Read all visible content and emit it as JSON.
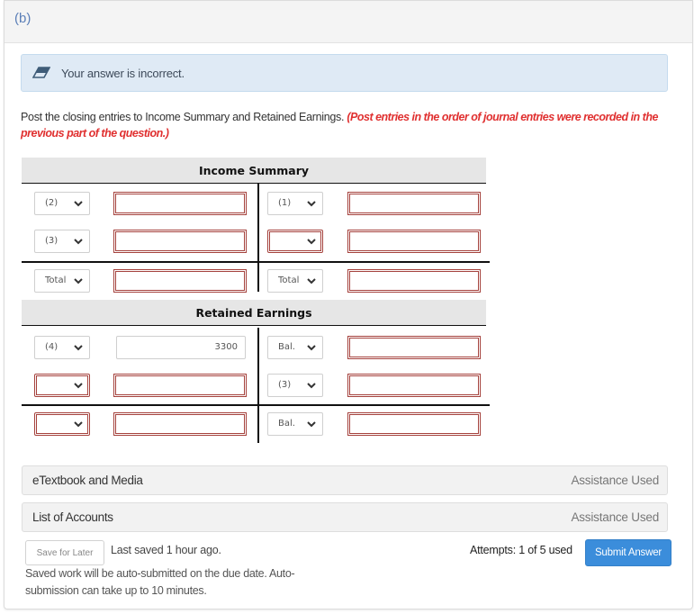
{
  "part": {
    "label": "(b)"
  },
  "feedback": {
    "icon": "eraser-icon",
    "text": "Your answer is incorrect."
  },
  "instructions": {
    "text": "Post the closing entries to Income Summary and Retained Earnings.",
    "note": "(Post entries in the order of journal entries were recorded in the previous part of the question.)"
  },
  "income_summary": {
    "title": "Income Summary",
    "debit_rows": [
      {
        "ref": "(2)",
        "amount": "",
        "ref_error": false,
        "amount_error": true
      },
      {
        "ref": "(3)",
        "amount": "",
        "ref_error": false,
        "amount_error": true
      }
    ],
    "credit_rows": [
      {
        "ref": "(1)",
        "amount": "",
        "ref_error": false,
        "amount_error": true
      },
      {
        "ref": "",
        "amount": "",
        "ref_error": true,
        "amount_error": true
      }
    ],
    "debit_total": {
      "ref": "Total",
      "amount": ""
    },
    "credit_total": {
      "ref": "Total",
      "amount": ""
    }
  },
  "retained_earnings": {
    "title": "Retained Earnings",
    "debit_rows": [
      {
        "ref": "(4)",
        "amount": "3300",
        "ref_error": false,
        "amount_error": false
      },
      {
        "ref": "",
        "amount": "",
        "ref_error": true,
        "amount_error": true
      }
    ],
    "credit_rows": [
      {
        "ref": "Bal.",
        "amount": "",
        "ref_error": false,
        "amount_error": true
      },
      {
        "ref": "(3)",
        "amount": "",
        "ref_error": false,
        "amount_error": true
      }
    ],
    "debit_bottom": {
      "ref": "",
      "amount": ""
    },
    "credit_bottom": {
      "ref": "Bal.",
      "amount": ""
    }
  },
  "resources": [
    {
      "name": "eTextbook and Media",
      "status": "Assistance Used"
    },
    {
      "name": "List of Accounts",
      "status": "Assistance Used"
    }
  ],
  "footer": {
    "save_label": "Save for Later",
    "last_saved": "Last saved 1 hour ago.",
    "autosubmit_note": "Saved work will be auto-submitted on the due date. Auto-submission can take up to 10 minutes.",
    "attempts": "Attempts: 1 of 5 used",
    "submit_label": "Submit Answer"
  },
  "colors": {
    "error_border": "#a5423d",
    "submit": "#3b8ddb",
    "alert_bg": "#dfeaf5",
    "note_red": "#e03030",
    "part_label": "#5b7fb8"
  }
}
